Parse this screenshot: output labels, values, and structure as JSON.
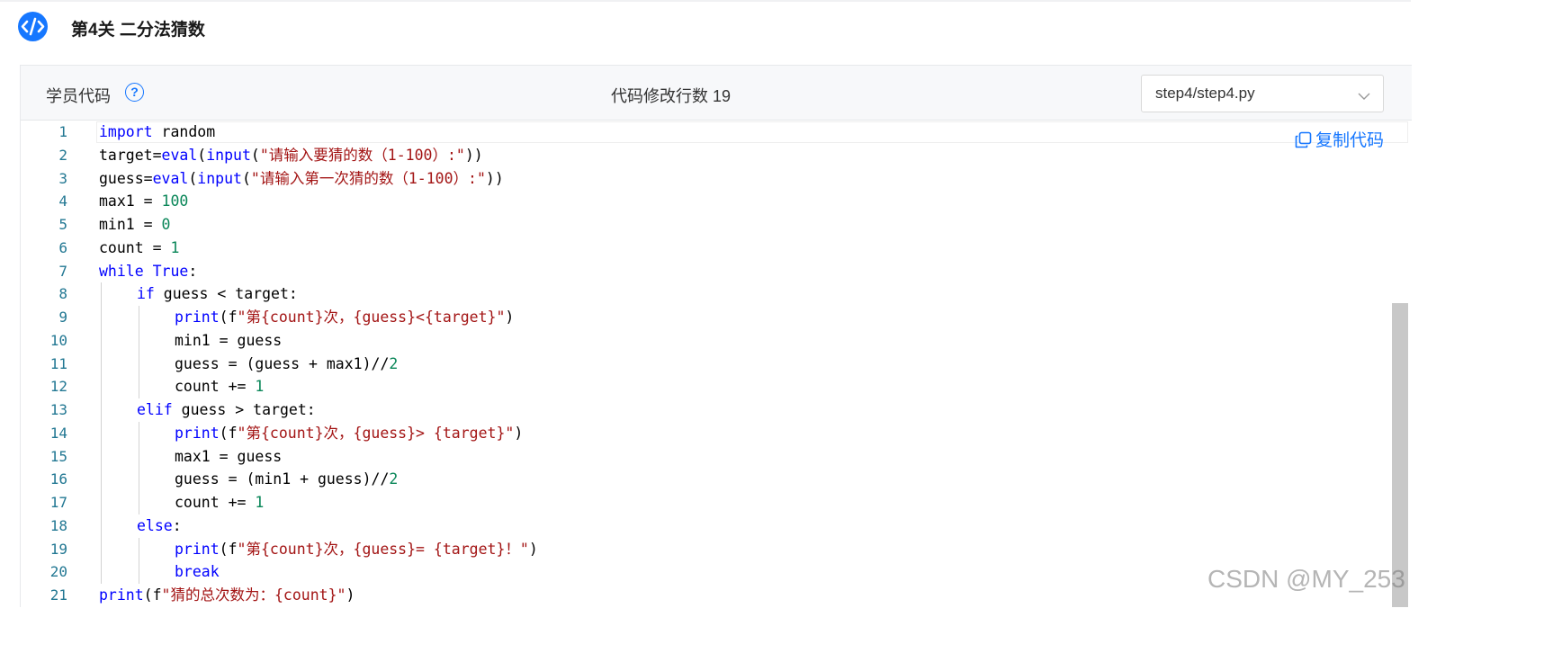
{
  "header": {
    "title": "第4关 二分法猜数"
  },
  "panel": {
    "student_label": "学员代码",
    "help_symbol": "?",
    "lines_changed": "代码修改行数 19",
    "file_select": {
      "value": "step4/step4.py"
    },
    "copy_label": "复制代码"
  },
  "code": {
    "line_numbers": [
      "1",
      "2",
      "3",
      "4",
      "5",
      "6",
      "7",
      "8",
      "9",
      "10",
      "11",
      "12",
      "13",
      "14",
      "15",
      "16",
      "17",
      "18",
      "19",
      "20",
      "21"
    ],
    "lines": [
      {
        "indent": 0,
        "tokens": [
          {
            "t": "kw",
            "v": "import"
          },
          {
            "t": "",
            "v": " random"
          }
        ]
      },
      {
        "indent": 0,
        "tokens": [
          {
            "t": "",
            "v": "target="
          },
          {
            "t": "fn",
            "v": "eval"
          },
          {
            "t": "",
            "v": "("
          },
          {
            "t": "fn",
            "v": "input"
          },
          {
            "t": "",
            "v": "("
          },
          {
            "t": "str",
            "v": "\"请输入要猜的数（1-100）:\""
          },
          {
            "t": "",
            "v": "))"
          }
        ]
      },
      {
        "indent": 0,
        "tokens": [
          {
            "t": "",
            "v": "guess="
          },
          {
            "t": "fn",
            "v": "eval"
          },
          {
            "t": "",
            "v": "("
          },
          {
            "t": "fn",
            "v": "input"
          },
          {
            "t": "",
            "v": "("
          },
          {
            "t": "str",
            "v": "\"请输入第一次猜的数（1-100）:\""
          },
          {
            "t": "",
            "v": "))"
          }
        ]
      },
      {
        "indent": 0,
        "tokens": [
          {
            "t": "",
            "v": "max1 = "
          },
          {
            "t": "num",
            "v": "100"
          }
        ]
      },
      {
        "indent": 0,
        "tokens": [
          {
            "t": "",
            "v": "min1 = "
          },
          {
            "t": "num",
            "v": "0"
          }
        ]
      },
      {
        "indent": 0,
        "tokens": [
          {
            "t": "",
            "v": "count = "
          },
          {
            "t": "num",
            "v": "1"
          }
        ]
      },
      {
        "indent": 0,
        "tokens": [
          {
            "t": "kw",
            "v": "while"
          },
          {
            "t": "",
            "v": " "
          },
          {
            "t": "kw",
            "v": "True"
          },
          {
            "t": "",
            "v": ":"
          }
        ]
      },
      {
        "indent": 1,
        "tokens": [
          {
            "t": "kw",
            "v": "if"
          },
          {
            "t": "",
            "v": " guess < target:"
          }
        ]
      },
      {
        "indent": 2,
        "tokens": [
          {
            "t": "fn",
            "v": "print"
          },
          {
            "t": "",
            "v": "(f"
          },
          {
            "t": "str",
            "v": "\"第{count}次，{guess}<{target}\""
          },
          {
            "t": "",
            "v": ")"
          }
        ]
      },
      {
        "indent": 2,
        "tokens": [
          {
            "t": "",
            "v": "min1 = guess"
          }
        ]
      },
      {
        "indent": 2,
        "tokens": [
          {
            "t": "",
            "v": "guess = (guess + max1)//"
          },
          {
            "t": "num",
            "v": "2"
          }
        ]
      },
      {
        "indent": 2,
        "tokens": [
          {
            "t": "",
            "v": "count += "
          },
          {
            "t": "num",
            "v": "1"
          }
        ]
      },
      {
        "indent": 1,
        "tokens": [
          {
            "t": "kw",
            "v": "elif"
          },
          {
            "t": "",
            "v": " guess > target:"
          }
        ]
      },
      {
        "indent": 2,
        "tokens": [
          {
            "t": "fn",
            "v": "print"
          },
          {
            "t": "",
            "v": "(f"
          },
          {
            "t": "str",
            "v": "\"第{count}次，{guess}> {target}\""
          },
          {
            "t": "",
            "v": ")"
          }
        ]
      },
      {
        "indent": 2,
        "tokens": [
          {
            "t": "",
            "v": "max1 = guess"
          }
        ]
      },
      {
        "indent": 2,
        "tokens": [
          {
            "t": "",
            "v": "guess = (min1 + guess)//"
          },
          {
            "t": "num",
            "v": "2"
          }
        ]
      },
      {
        "indent": 2,
        "tokens": [
          {
            "t": "",
            "v": "count += "
          },
          {
            "t": "num",
            "v": "1"
          }
        ]
      },
      {
        "indent": 1,
        "tokens": [
          {
            "t": "kw",
            "v": "else"
          },
          {
            "t": "",
            "v": ":"
          }
        ]
      },
      {
        "indent": 2,
        "tokens": [
          {
            "t": "fn",
            "v": "print"
          },
          {
            "t": "",
            "v": "(f"
          },
          {
            "t": "str",
            "v": "\"第{count}次，{guess}= {target}！\""
          },
          {
            "t": "",
            "v": ")"
          }
        ]
      },
      {
        "indent": 2,
        "tokens": [
          {
            "t": "kw",
            "v": "break"
          }
        ]
      },
      {
        "indent": 0,
        "tokens": [
          {
            "t": "fn",
            "v": "print"
          },
          {
            "t": "",
            "v": "(f"
          },
          {
            "t": "str",
            "v": "\"猜的总次数为：{count}\""
          },
          {
            "t": "",
            "v": ")"
          }
        ]
      }
    ]
  },
  "watermark": "CSDN @MY_253",
  "icons": {
    "logo": "code-logo-icon",
    "help": "help-circle-icon",
    "copy": "copy-icon",
    "select_arrow": "chevron-down-icon"
  },
  "colors": {
    "accent": "#1677ff",
    "keyword": "#0000ff",
    "string": "#a31515",
    "number": "#098658",
    "line_number": "#237893"
  }
}
